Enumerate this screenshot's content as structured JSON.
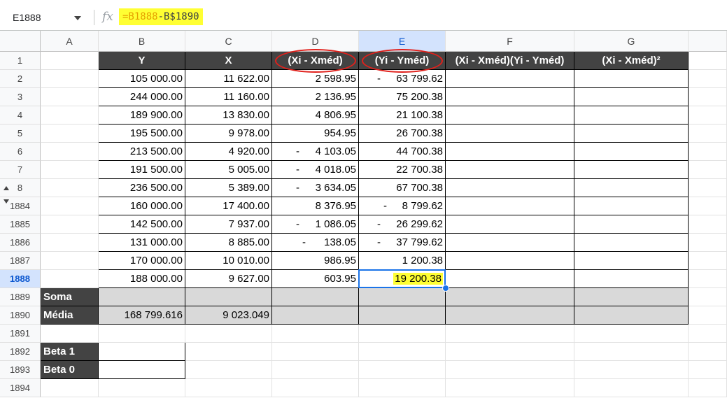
{
  "name_box": "E1888",
  "formula": {
    "ref1": "=B1888",
    "rest": "-B$1890"
  },
  "columns": [
    "A",
    "B",
    "C",
    "D",
    "E",
    "F",
    "G"
  ],
  "headers": {
    "B": "Y",
    "C": "X",
    "D": "(Xi - Xméd)",
    "E": "(Yi - Yméd)",
    "F": "(Xi - Xméd)(Yi - Yméd)",
    "G": "(Xi - Xméd)²"
  },
  "rows": [
    {
      "n": "1"
    },
    {
      "n": "2",
      "B": "105 000.00",
      "C": "11 622.00",
      "D": "2 598.95",
      "E": "63 799.62",
      "En": true
    },
    {
      "n": "3",
      "B": "244 000.00",
      "C": "11 160.00",
      "D": "2 136.95",
      "E": "75 200.38"
    },
    {
      "n": "4",
      "B": "189 900.00",
      "C": "13 830.00",
      "D": "4 806.95",
      "E": "21 100.38"
    },
    {
      "n": "5",
      "B": "195 500.00",
      "C": "9 978.00",
      "D": "954.95",
      "E": "26 700.38"
    },
    {
      "n": "6",
      "B": "213 500.00",
      "C": "4 920.00",
      "D": "4 103.05",
      "Dn": true,
      "E": "44 700.38"
    },
    {
      "n": "7",
      "B": "191 500.00",
      "C": "5 005.00",
      "D": "4 018.05",
      "Dn": true,
      "E": "22 700.38"
    },
    {
      "n": "8",
      "B": "236 500.00",
      "C": "5 389.00",
      "D": "3 634.05",
      "Dn": true,
      "E": "67 700.38"
    },
    {
      "n": "1884",
      "B": "160 000.00",
      "C": "17 400.00",
      "D": "8 376.95",
      "E": "8 799.62",
      "En": true
    },
    {
      "n": "1885",
      "B": "142 500.00",
      "C": "7 937.00",
      "D": "1 086.05",
      "Dn": true,
      "E": "26 299.62",
      "En": true
    },
    {
      "n": "1886",
      "B": "131 000.00",
      "C": "8 885.00",
      "D": "138.05",
      "Dn": true,
      "E": "37 799.62",
      "En": true
    },
    {
      "n": "1887",
      "B": "170 000.00",
      "C": "10 010.00",
      "D": "986.95",
      "E": "1 200.38"
    },
    {
      "n": "1888",
      "B": "188 000.00",
      "C": "9 627.00",
      "D": "603.95",
      "E": "19 200.38"
    },
    {
      "n": "1889",
      "A": "Soma"
    },
    {
      "n": "1890",
      "A": "Média",
      "B": "168 799.616",
      "C": "9 023.049"
    },
    {
      "n": "1891"
    },
    {
      "n": "1892",
      "A": "Beta 1"
    },
    {
      "n": "1893",
      "A": "Beta 0"
    },
    {
      "n": "1894"
    }
  ],
  "neg_sign": "-",
  "colors": {
    "header_bg": "#434343",
    "gray_bg": "#d9d9d9",
    "highlight": "#ffff33",
    "selection": "#1a73e8",
    "annotation": "#e0201b"
  }
}
